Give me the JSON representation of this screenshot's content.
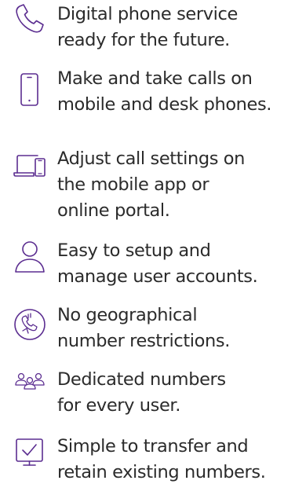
{
  "accent_color": "#5b2d90",
  "features": [
    {
      "icon": "phone-handset-icon",
      "text": "Digital phone service\nready for the future."
    },
    {
      "icon": "mobile-phone-icon",
      "text": "Make and take calls on\nmobile and desk phones."
    },
    {
      "icon": "laptop-mobile-icon",
      "text": "Adjust call settings on\nthe mobile app or\nonline portal."
    },
    {
      "icon": "user-icon",
      "text": "Easy to setup and\nmanage user accounts."
    },
    {
      "icon": "no-geography-phone-icon",
      "text": "No geographical\nnumber restrictions."
    },
    {
      "icon": "user-group-icon",
      "text": "Dedicated numbers\nfor every user."
    },
    {
      "icon": "transfer-check-icon",
      "text": "Simple to transfer and\nretain existing numbers."
    }
  ]
}
